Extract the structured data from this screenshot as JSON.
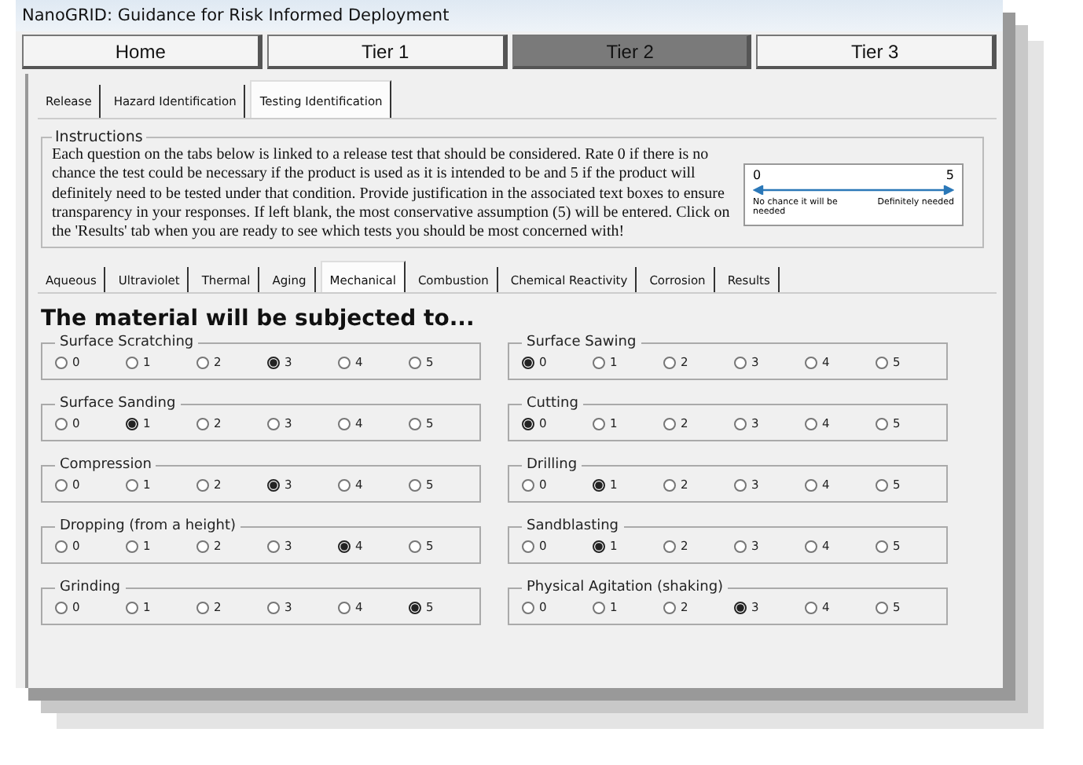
{
  "window": {
    "title": "NanoGRID: Guidance for Risk Informed Deployment"
  },
  "top_tabs": [
    {
      "label": "Home",
      "selected": false
    },
    {
      "label": "Tier 1",
      "selected": false
    },
    {
      "label": "Tier 2",
      "selected": true
    },
    {
      "label": "Tier 3",
      "selected": false
    }
  ],
  "sub_tabs": [
    {
      "label": "Release",
      "selected": false
    },
    {
      "label": "Hazard Identification",
      "selected": false
    },
    {
      "label": "Testing Identification",
      "selected": true
    }
  ],
  "instructions": {
    "title": "Instructions",
    "text": "Each question on the tabs below is linked to a release test that should be considered. Rate 0 if there is no chance the test could be necessary if the product is used as it is intended to be and 5 if the product will definitely need to be tested under that condition. Provide justification in the associated text boxes to ensure transparency in your responses. If left blank, the most conservative assumption (5) will be entered. Click on the 'Results' tab when you are ready to see which tests you should be most concerned with!",
    "scale": {
      "min": "0",
      "max": "5",
      "min_caption": "No chance it will be needed",
      "max_caption": "Definitely needed"
    }
  },
  "test_tabs": [
    {
      "label": "Aqueous",
      "selected": false
    },
    {
      "label": "Ultraviolet",
      "selected": false
    },
    {
      "label": "Thermal",
      "selected": false
    },
    {
      "label": "Aging",
      "selected": false
    },
    {
      "label": "Mechanical",
      "selected": true
    },
    {
      "label": "Combustion",
      "selected": false
    },
    {
      "label": "Chemical Reactivity",
      "selected": false
    },
    {
      "label": "Corrosion",
      "selected": false
    },
    {
      "label": "Results",
      "selected": false
    }
  ],
  "heading": "The material will be subjected to...",
  "questions": [
    {
      "label": "Surface Scratching",
      "options": [
        {
          "label": "0",
          "selected": false
        },
        {
          "label": "1",
          "selected": false
        },
        {
          "label": "2",
          "selected": false
        },
        {
          "label": "3",
          "selected": true
        },
        {
          "label": "4",
          "selected": false
        },
        {
          "label": "5",
          "selected": false
        }
      ]
    },
    {
      "label": "Surface Sawing",
      "options": [
        {
          "label": "0",
          "selected": true
        },
        {
          "label": "1",
          "selected": false
        },
        {
          "label": "2",
          "selected": false
        },
        {
          "label": "3",
          "selected": false
        },
        {
          "label": "4",
          "selected": false
        },
        {
          "label": "5",
          "selected": false
        }
      ]
    },
    {
      "label": "Surface Sanding",
      "options": [
        {
          "label": "0",
          "selected": false
        },
        {
          "label": "1",
          "selected": true
        },
        {
          "label": "2",
          "selected": false
        },
        {
          "label": "3",
          "selected": false
        },
        {
          "label": "4",
          "selected": false
        },
        {
          "label": "5",
          "selected": false
        }
      ]
    },
    {
      "label": "Cutting",
      "options": [
        {
          "label": "0",
          "selected": true
        },
        {
          "label": "1",
          "selected": false
        },
        {
          "label": "2",
          "selected": false
        },
        {
          "label": "3",
          "selected": false
        },
        {
          "label": "4",
          "selected": false
        },
        {
          "label": "5",
          "selected": false
        }
      ]
    },
    {
      "label": "Compression",
      "options": [
        {
          "label": "0",
          "selected": false
        },
        {
          "label": "1",
          "selected": false
        },
        {
          "label": "2",
          "selected": false
        },
        {
          "label": "3",
          "selected": true
        },
        {
          "label": "4",
          "selected": false
        },
        {
          "label": "5",
          "selected": false
        }
      ]
    },
    {
      "label": "Drilling",
      "options": [
        {
          "label": "0",
          "selected": false
        },
        {
          "label": "1",
          "selected": true
        },
        {
          "label": "2",
          "selected": false
        },
        {
          "label": "3",
          "selected": false
        },
        {
          "label": "4",
          "selected": false
        },
        {
          "label": "5",
          "selected": false
        }
      ]
    },
    {
      "label": "Dropping (from a height)",
      "options": [
        {
          "label": "0",
          "selected": false
        },
        {
          "label": "1",
          "selected": false
        },
        {
          "label": "2",
          "selected": false
        },
        {
          "label": "3",
          "selected": false
        },
        {
          "label": "4",
          "selected": true
        },
        {
          "label": "5",
          "selected": false
        }
      ]
    },
    {
      "label": "Sandblasting",
      "options": [
        {
          "label": "0",
          "selected": false
        },
        {
          "label": "1",
          "selected": true
        },
        {
          "label": "2",
          "selected": false
        },
        {
          "label": "3",
          "selected": false
        },
        {
          "label": "4",
          "selected": false
        },
        {
          "label": "5",
          "selected": false
        }
      ]
    },
    {
      "label": "Grinding",
      "options": [
        {
          "label": "0",
          "selected": false
        },
        {
          "label": "1",
          "selected": false
        },
        {
          "label": "2",
          "selected": false
        },
        {
          "label": "3",
          "selected": false
        },
        {
          "label": "4",
          "selected": false
        },
        {
          "label": "5",
          "selected": true
        }
      ]
    },
    {
      "label": "Physical Agitation (shaking)",
      "options": [
        {
          "label": "0",
          "selected": false
        },
        {
          "label": "1",
          "selected": false
        },
        {
          "label": "2",
          "selected": false
        },
        {
          "label": "3",
          "selected": true
        },
        {
          "label": "4",
          "selected": false
        },
        {
          "label": "5",
          "selected": false
        }
      ]
    }
  ]
}
